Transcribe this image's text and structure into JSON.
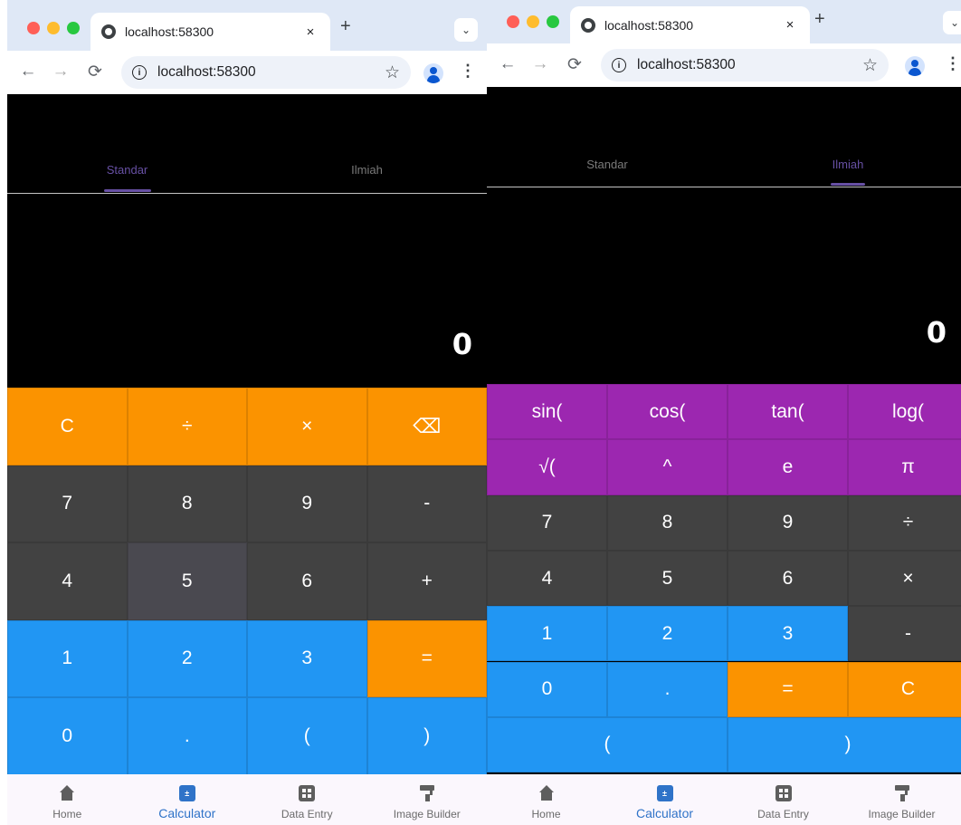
{
  "window1": {
    "browser": {
      "tab_title": "localhost:58300",
      "tab_close": "×",
      "new_tab": "+",
      "tab_menu": "⌄",
      "url": "localhost:58300",
      "back": "←",
      "forward": "→",
      "reload": "⟳",
      "info": "i",
      "star": "☆",
      "kebab": "⋮"
    },
    "app_tabs": [
      {
        "label": "Standar",
        "selected": true
      },
      {
        "label": "Ilmiah",
        "selected": false
      }
    ],
    "display": "0",
    "keys": [
      {
        "label": "C",
        "style": "orange"
      },
      {
        "label": "÷",
        "style": "orange"
      },
      {
        "label": "×",
        "style": "orange"
      },
      {
        "label": "⌫",
        "style": "orange",
        "icon": "backspace-icon"
      },
      {
        "label": "7",
        "style": "dark"
      },
      {
        "label": "8",
        "style": "dark"
      },
      {
        "label": "9",
        "style": "dark"
      },
      {
        "label": "-",
        "style": "dark"
      },
      {
        "label": "4",
        "style": "dark"
      },
      {
        "label": "5",
        "style": "hover"
      },
      {
        "label": "6",
        "style": "dark"
      },
      {
        "label": "+",
        "style": "dark"
      },
      {
        "label": "1",
        "style": "blue"
      },
      {
        "label": "2",
        "style": "blue"
      },
      {
        "label": "3",
        "style": "blue"
      },
      {
        "label": "=",
        "style": "orange"
      },
      {
        "label": "0",
        "style": "blue"
      },
      {
        "label": ".",
        "style": "blue"
      },
      {
        "label": "(",
        "style": "blue"
      },
      {
        "label": ")",
        "style": "blue"
      }
    ],
    "bottom_nav": [
      {
        "label": "Home",
        "icon": "home-icon"
      },
      {
        "label": "Calculator",
        "icon": "calculator-icon",
        "active": true
      },
      {
        "label": "Data Entry",
        "icon": "grid-icon"
      },
      {
        "label": "Image Builder",
        "icon": "paint-roller-icon"
      }
    ]
  },
  "window2": {
    "browser": {
      "tab_title": "localhost:58300",
      "tab_close": "×",
      "new_tab": "+",
      "tab_menu": "⌄",
      "url": "localhost:58300",
      "back": "←",
      "forward": "→",
      "reload": "⟳",
      "info": "i",
      "star": "☆",
      "kebab": "⋮"
    },
    "app_tabs": [
      {
        "label": "Standar",
        "selected": false
      },
      {
        "label": "Ilmiah",
        "selected": true
      }
    ],
    "display": "0",
    "keys": [
      {
        "label": "sin(",
        "style": "purple"
      },
      {
        "label": "cos(",
        "style": "purple"
      },
      {
        "label": "tan(",
        "style": "purple"
      },
      {
        "label": "log(",
        "style": "purple"
      },
      {
        "label": "√(",
        "style": "purple"
      },
      {
        "label": "^",
        "style": "purple"
      },
      {
        "label": "e",
        "style": "purple"
      },
      {
        "label": "π",
        "style": "purple"
      },
      {
        "label": "7",
        "style": "dark"
      },
      {
        "label": "8",
        "style": "dark"
      },
      {
        "label": "9",
        "style": "dark"
      },
      {
        "label": "÷",
        "style": "dark"
      },
      {
        "label": "4",
        "style": "dark"
      },
      {
        "label": "5",
        "style": "dark"
      },
      {
        "label": "6",
        "style": "dark"
      },
      {
        "label": "×",
        "style": "dark"
      },
      {
        "label": "1",
        "style": "blue"
      },
      {
        "label": "2",
        "style": "blue"
      },
      {
        "label": "3",
        "style": "blue"
      },
      {
        "label": "-",
        "style": "dark"
      },
      {
        "label": "0",
        "style": "blue"
      },
      {
        "label": ".",
        "style": "blue"
      },
      {
        "label": "=",
        "style": "orange"
      },
      {
        "label": "C",
        "style": "orange"
      },
      {
        "label": "(",
        "style": "blue"
      },
      {
        "label": ")",
        "style": "blue"
      }
    ],
    "bottom_nav": [
      {
        "label": "Home",
        "icon": "home-icon"
      },
      {
        "label": "Calculator",
        "icon": "calculator-icon",
        "active": true
      },
      {
        "label": "Data Entry",
        "icon": "grid-icon"
      },
      {
        "label": "Image Builder",
        "icon": "paint-roller-icon"
      }
    ]
  },
  "colors": {
    "orange": "#fb9300",
    "dark": "#424242",
    "blue": "#2196f3",
    "purple": "#9c27b0",
    "tab_indicator": "#6750a4",
    "nav_active": "#2f73c8"
  }
}
